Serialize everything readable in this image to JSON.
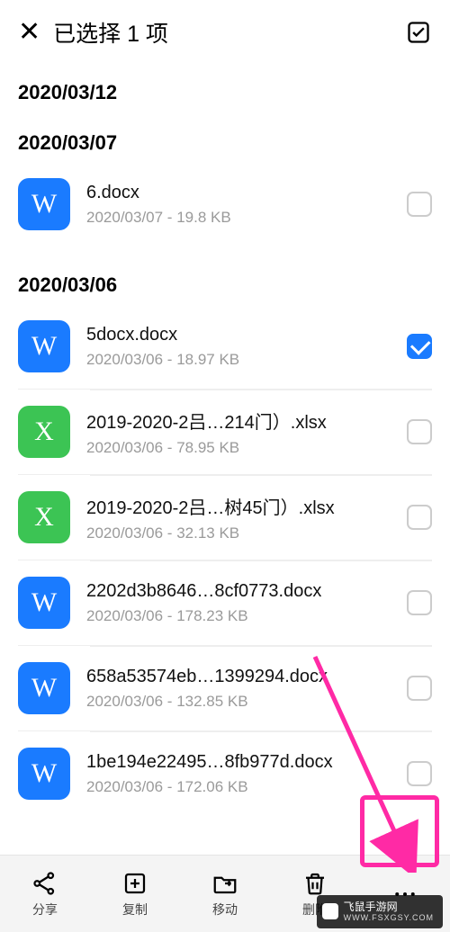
{
  "header": {
    "title": "已选择 1 项"
  },
  "groups": [
    {
      "date": "2020/03/12",
      "files": []
    },
    {
      "date": "2020/03/07",
      "files": [
        {
          "icon": "W",
          "iconClass": "ic-w",
          "name": "6.docx",
          "sub": "2020/03/07 - 19.8 KB",
          "checked": false
        }
      ]
    },
    {
      "date": "2020/03/06",
      "files": [
        {
          "icon": "W",
          "iconClass": "ic-w",
          "name": "5docx.docx",
          "sub": "2020/03/06 - 18.97 KB",
          "checked": true
        },
        {
          "icon": "X",
          "iconClass": "ic-x",
          "name": "2019-2020-2吕…214门）.xlsx",
          "sub": "2020/03/06 - 78.95 KB",
          "checked": false
        },
        {
          "icon": "X",
          "iconClass": "ic-x",
          "name": "2019-2020-2吕…树45门）.xlsx",
          "sub": "2020/03/06 - 32.13 KB",
          "checked": false
        },
        {
          "icon": "W",
          "iconClass": "ic-w",
          "name": "2202d3b8646…8cf0773.docx",
          "sub": "2020/03/06 - 178.23 KB",
          "checked": false
        },
        {
          "icon": "W",
          "iconClass": "ic-w",
          "name": "658a53574eb…1399294.docx",
          "sub": "2020/03/06 - 132.85 KB",
          "checked": false
        },
        {
          "icon": "W",
          "iconClass": "ic-w",
          "name": "1be194e22495…8fb977d.docx",
          "sub": "2020/03/06 - 172.06 KB",
          "checked": false
        }
      ]
    }
  ],
  "bottomBar": {
    "share": "分享",
    "copy": "复制",
    "move": "移动",
    "delete": "删附"
  },
  "watermark": {
    "line1": "飞鼠手游网",
    "line2": "WWW.FSXGSY.COM"
  }
}
